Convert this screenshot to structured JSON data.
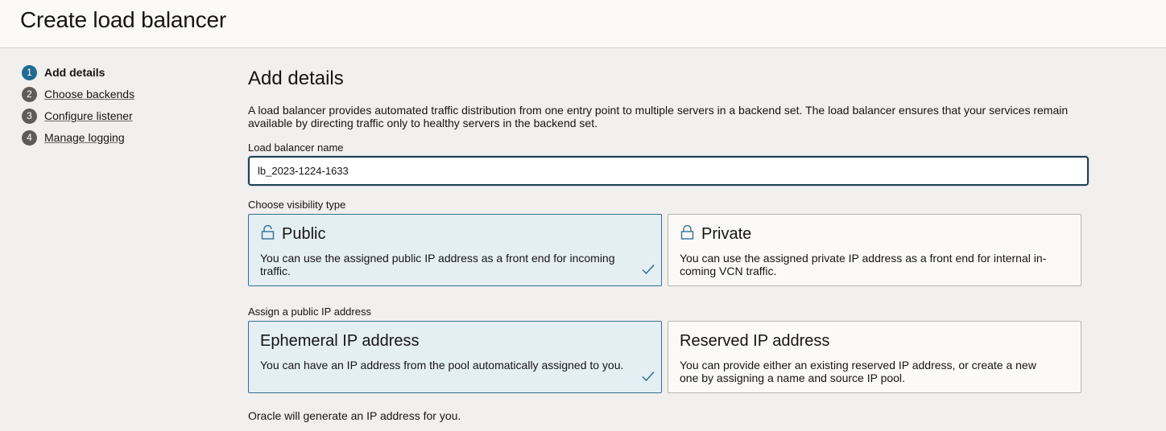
{
  "header": {
    "title": "Create load balancer"
  },
  "steps": [
    {
      "num": "1",
      "label": "Add details"
    },
    {
      "num": "2",
      "label": "Choose backends"
    },
    {
      "num": "3",
      "label": "Configure listener"
    },
    {
      "num": "4",
      "label": "Manage logging"
    }
  ],
  "main": {
    "title": "Add details",
    "description": "A load balancer provides automated traffic distribution from one entry point to multiple servers in a backend set. The load balancer ensures that your services remain available by directing traffic only to healthy servers in the backend set.",
    "name_label": "Load balancer name",
    "name_value": "lb_2023-1224-1633",
    "visibility_label": "Choose visibility type",
    "visibility": [
      {
        "title": "Public",
        "text": "You can use the assigned public IP address as a front end for incoming traffic.",
        "selected": true
      },
      {
        "title": "Private",
        "text": "You can use the assigned private IP address as a front end for internal in-coming VCN traffic.",
        "selected": false
      }
    ],
    "ip_label": "Assign a public IP address",
    "ip_options": [
      {
        "title": "Ephemeral IP address",
        "text": "You can have an IP address from the pool automatically assigned to you.",
        "selected": true
      },
      {
        "title": "Reserved IP address",
        "text": "You can provide either an existing reserved IP address, or create a new one by assigning a name and source IP pool.",
        "selected": false
      }
    ],
    "footer_note": "Oracle will generate an IP address for you."
  },
  "colors": {
    "accent": "#1f6a91",
    "selected_bg": "#e4eff4",
    "selected_border": "#356f8f",
    "check": "#356f8f"
  },
  "icons": {
    "lock": "lock-icon",
    "check": "checkmark-icon"
  }
}
